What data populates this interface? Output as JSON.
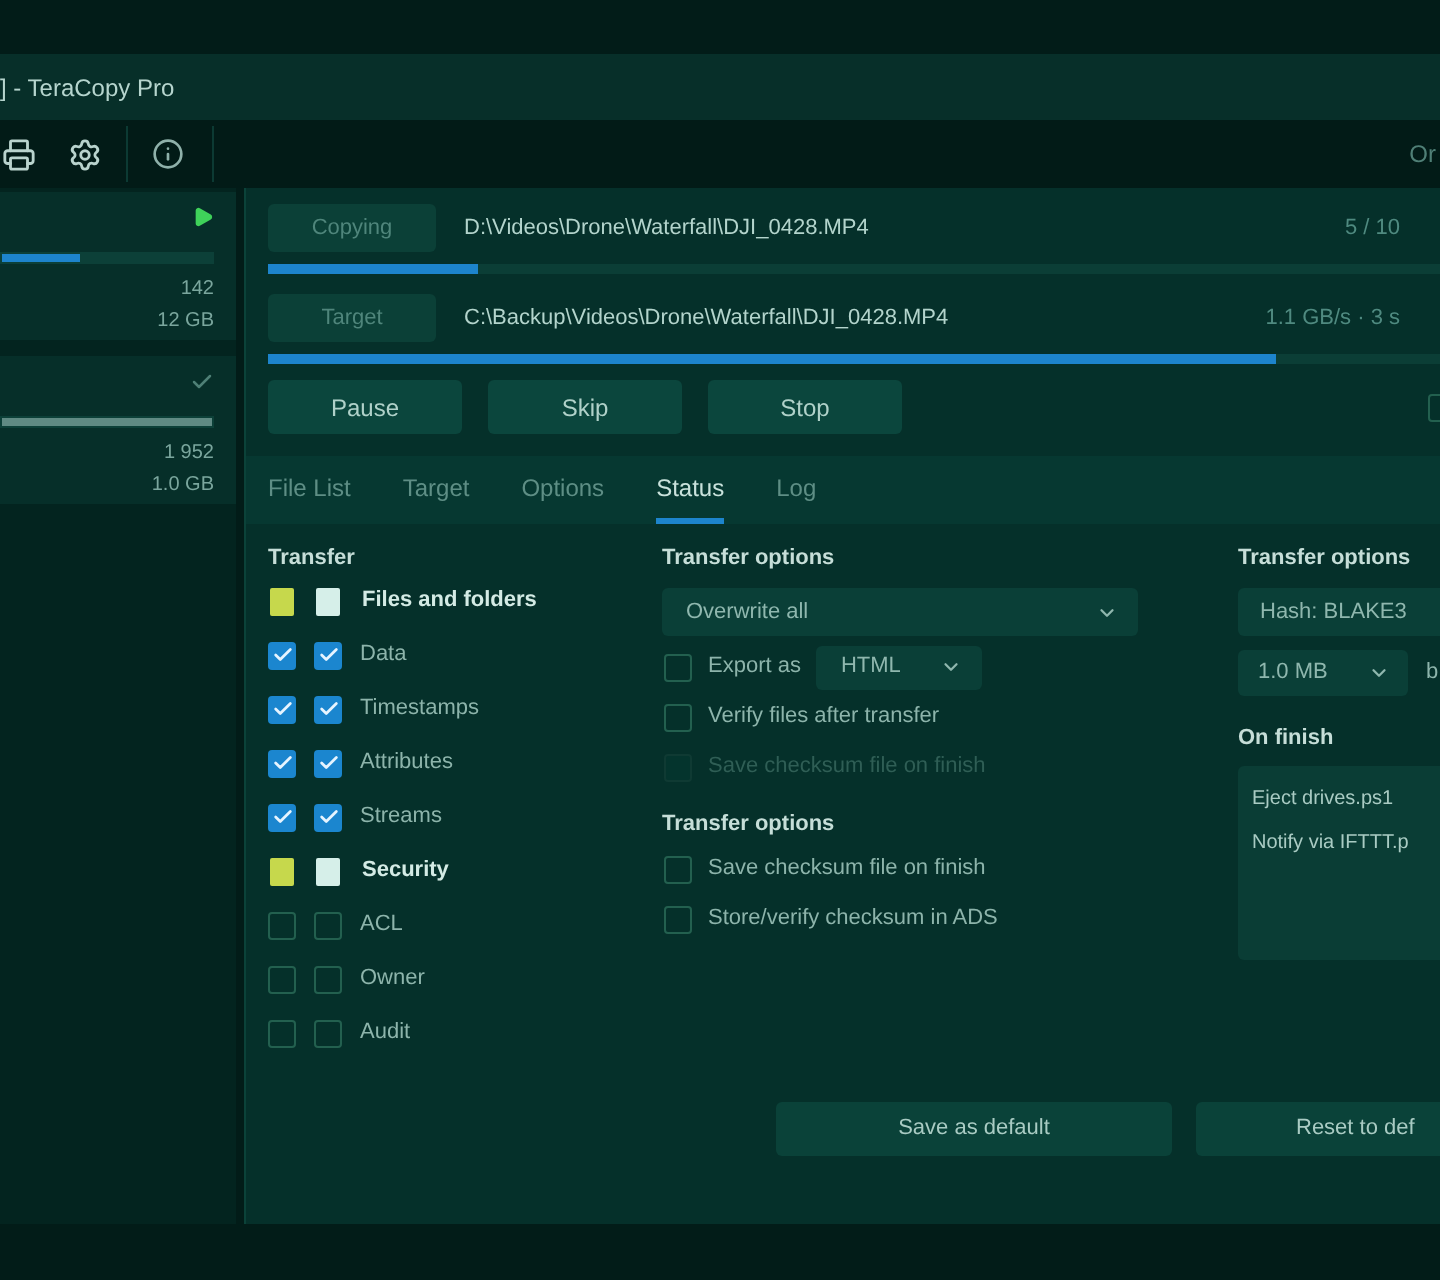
{
  "window": {
    "title": "] - TeraCopy Pro"
  },
  "toolbar": {
    "trailing_text": "Or"
  },
  "queue": [
    {
      "kind": "running",
      "level": 0.37,
      "count": "142",
      "size": "12 GB"
    },
    {
      "kind": "done",
      "level": 1,
      "count": "1 952",
      "size": "1.0 GB"
    }
  ],
  "transfer": [
    {
      "label": "Copying",
      "path": "D:\\Videos\\Drone\\Waterfall\\DJI_0428.MP4",
      "info": "5 / 10",
      "level": 0.18
    },
    {
      "label": "Target",
      "path": "C:\\Backup\\Videos\\Drone\\Waterfall\\DJI_0428.MP4",
      "info": "1.1 GB/s · 3 s",
      "level": 0.86
    }
  ],
  "controls": {
    "buttons": [
      "Pause",
      "Skip",
      "Stop"
    ],
    "option_checkbox": {
      "checked": false
    }
  },
  "tabs": [
    {
      "label": "File List",
      "selected": false
    },
    {
      "label": "Target",
      "selected": false
    },
    {
      "label": "Options",
      "selected": false
    },
    {
      "label": "Status",
      "selected": true
    },
    {
      "label": "Log",
      "selected": false
    }
  ],
  "status": {
    "transfer": {
      "title": "Transfer",
      "rows": [
        {
          "kind": "group",
          "label": "Files and folders",
          "mixed": true
        },
        {
          "kind": "item",
          "label": "Data",
          "checked": true
        },
        {
          "kind": "item",
          "label": "Timestamps",
          "checked": true
        },
        {
          "kind": "item",
          "label": "Attributes",
          "checked": true
        },
        {
          "kind": "item",
          "label": "Streams",
          "checked": true
        },
        {
          "kind": "group",
          "label": "Security",
          "mixed": true
        },
        {
          "kind": "item",
          "label": "ACL",
          "checked": false
        },
        {
          "kind": "item",
          "label": "Owner",
          "checked": false
        },
        {
          "kind": "item",
          "label": "Audit",
          "checked": false
        }
      ]
    },
    "options": {
      "title": "Transfer options",
      "mode": "Overwrite all",
      "items": [
        {
          "kind": "export",
          "label": "Export as",
          "format": "HTML",
          "checked": false,
          "disabled": false
        },
        {
          "kind": "check",
          "label": "Verify files after transfer",
          "checked": false,
          "disabled": false
        },
        {
          "kind": "check",
          "label": "Save checksum file on finish",
          "checked": false,
          "disabled": true
        }
      ]
    },
    "checksum": {
      "title": "Transfer options",
      "items": [
        {
          "label": "Save checksum file on finish",
          "checked": false
        },
        {
          "label": "Store/verify checksum in ADS",
          "checked": false
        }
      ]
    },
    "hash": {
      "title": "Transfer options",
      "algorithm": "Hash: BLAKE3",
      "block_size": "1.0 MB",
      "block_label": "b"
    },
    "on_finish": {
      "title": "On finish",
      "scripts": [
        "Eject drives.ps1",
        "Notify via IFTTT.p"
      ]
    }
  },
  "footer": {
    "buttons": [
      "Save as default",
      "Reset to def"
    ]
  }
}
